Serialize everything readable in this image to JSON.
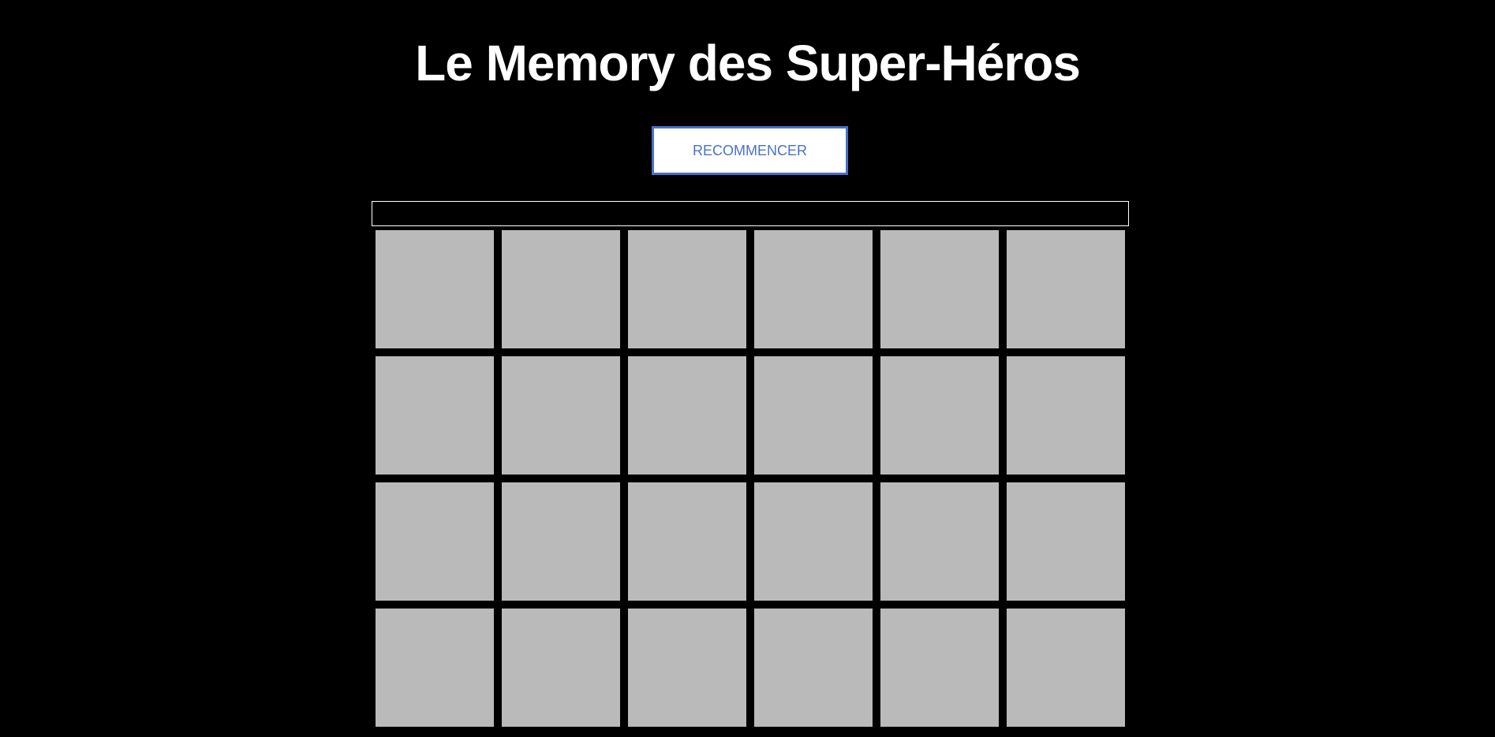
{
  "header": {
    "title": "Le Memory des Super-Héros"
  },
  "controls": {
    "restart_label": "RECOMMENCER"
  },
  "progress": {
    "value": 0
  },
  "board": {
    "columns": 6,
    "rows": 4,
    "cards": [
      {
        "state": "face-down"
      },
      {
        "state": "face-down"
      },
      {
        "state": "face-down"
      },
      {
        "state": "face-down"
      },
      {
        "state": "face-down"
      },
      {
        "state": "face-down"
      },
      {
        "state": "face-down"
      },
      {
        "state": "face-down"
      },
      {
        "state": "face-down"
      },
      {
        "state": "face-down"
      },
      {
        "state": "face-down"
      },
      {
        "state": "face-down"
      },
      {
        "state": "face-down"
      },
      {
        "state": "face-down"
      },
      {
        "state": "face-down"
      },
      {
        "state": "face-down"
      },
      {
        "state": "face-down"
      },
      {
        "state": "face-down"
      },
      {
        "state": "face-down"
      },
      {
        "state": "face-down"
      },
      {
        "state": "face-down"
      },
      {
        "state": "face-down"
      },
      {
        "state": "face-down"
      },
      {
        "state": "face-down"
      }
    ]
  },
  "colors": {
    "background": "#000000",
    "card_back": "#bababa",
    "accent": "#4a72c9",
    "title": "#ffffff"
  }
}
